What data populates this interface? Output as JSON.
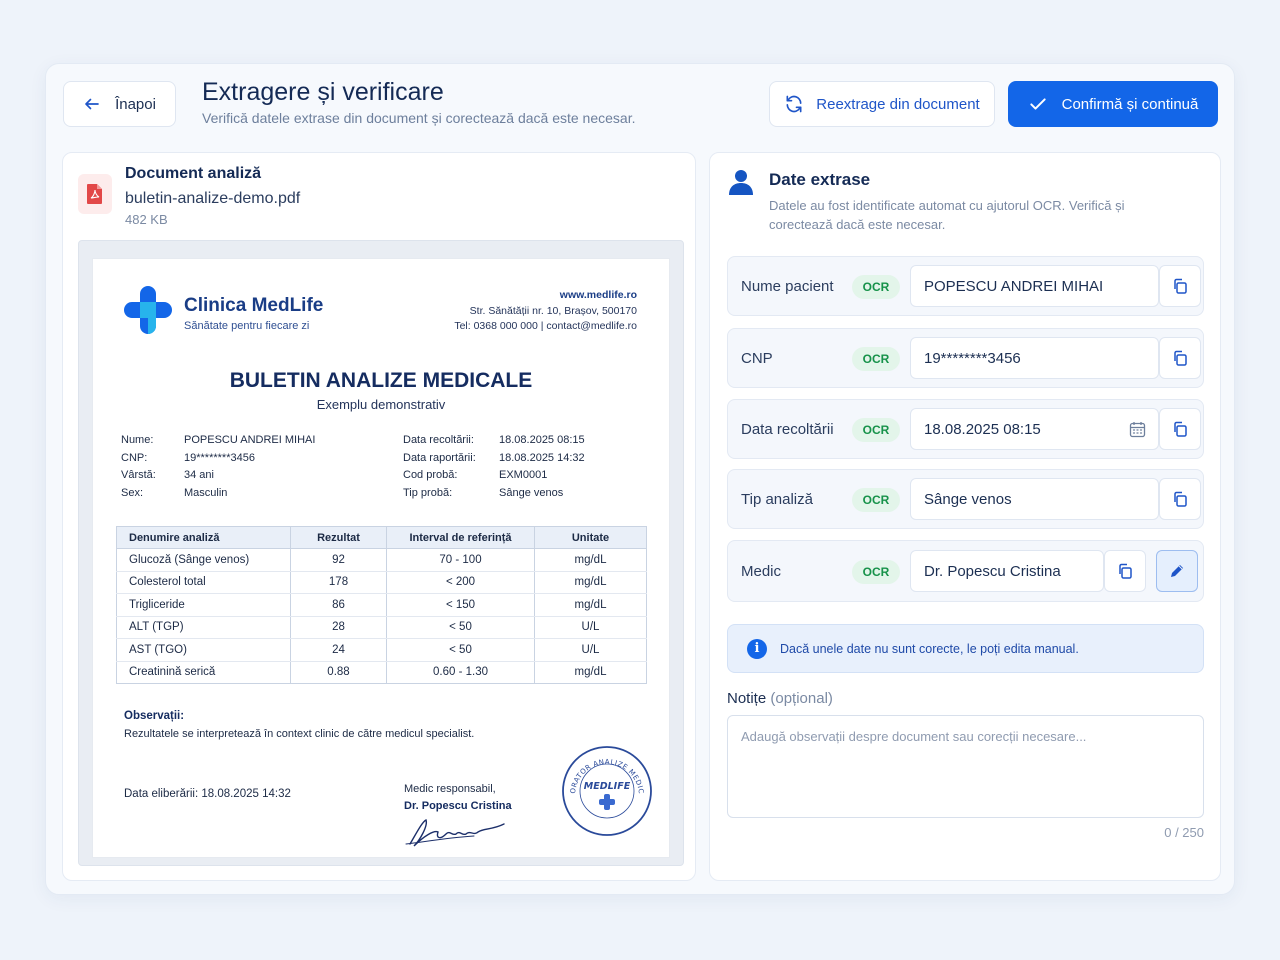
{
  "header": {
    "back_label": "Înapoi",
    "title": "Extragere și verificare",
    "subtitle": "Verifică datele extrase din document și corectează dacă este necesar.",
    "reextract_label": "Reextrage din document",
    "confirm_label": "Confirmă și continuă"
  },
  "document": {
    "label": "Document analiză",
    "filename": "buletin-analize-demo.pdf",
    "size": "482 KB",
    "icon": "pdf-file-icon"
  },
  "preview": {
    "clinic_name": "Clinica MedLife",
    "clinic_tagline": "Sănătate pentru fiecare zi",
    "website": "www.medlife.ro",
    "address": "Str. Sănătății nr. 10, Brașov, 500170",
    "phone_email": "Tel: 0368 000 000  |  contact@medlife.ro",
    "title": "BULETIN ANALIZE MEDICALE",
    "subtitle": "Exemplu demonstrativ",
    "patient_left": {
      "labels": [
        "Nume:",
        "CNP:",
        "Vârstă:",
        "Sex:"
      ],
      "values": [
        "POPESCU ANDREI MIHAI",
        "19********3456",
        "34 ani",
        "Masculin"
      ]
    },
    "patient_right": {
      "labels": [
        "Data recoltării:",
        "Data raportării:",
        "Cod probă:",
        "Tip probă:"
      ],
      "values": [
        "18.08.2025 08:15",
        "18.08.2025 14:32",
        "EXM0001",
        "Sânge venos"
      ]
    },
    "table": {
      "headers": [
        "Denumire analiză",
        "Rezultat",
        "Interval de referință",
        "Unitate"
      ],
      "rows": [
        [
          "Glucoză (Sânge venos)",
          "92",
          "70 - 100",
          "mg/dL"
        ],
        [
          "Colesterol total",
          "178",
          "< 200",
          "mg/dL"
        ],
        [
          "Trigliceride",
          "86",
          "< 150",
          "mg/dL"
        ],
        [
          "ALT (TGP)",
          "28",
          "< 50",
          "U/L"
        ],
        [
          "AST (TGO)",
          "24",
          "< 50",
          "U/L"
        ],
        [
          "Creatinină serică",
          "0.88",
          "0.60 - 1.30",
          "mg/dL"
        ]
      ]
    },
    "observations_title": "Observații:",
    "observations_text": "Rezultatele se interpretează în context clinic de către medicul specialist.",
    "release_date": "Data eliberării: 18.08.2025 14:32",
    "responsible_label": "Medic responsabil,",
    "responsible_name": "Dr. Popescu Cristina",
    "stamp_text": "LABORATOR ANALIZE MEDICALE",
    "stamp_center": "MEDLIFE"
  },
  "extracted": {
    "title": "Date extrase",
    "description": "Datele au fost identificate automat cu ajutorul OCR. Verifică și corectează dacă este necesar.",
    "ocr_badge": "OCR",
    "fields": [
      {
        "label": "Nume pacient",
        "value": "POPESCU ANDREI MIHAI"
      },
      {
        "label": "CNP",
        "value": "19********3456"
      },
      {
        "label": "Data recoltării",
        "value": "18.08.2025 08:15"
      },
      {
        "label": "Tip analiză",
        "value": "Sânge venos"
      },
      {
        "label": "Medic",
        "value": "Dr. Popescu Cristina"
      }
    ]
  },
  "info_message": "Dacă unele date nu sunt corecte, le poți edita manual.",
  "notes": {
    "label": "Notițe",
    "optional": "(opțional)",
    "placeholder": "Adaugă observații despre document sau corecții necesare...",
    "counter": "0 / 250"
  },
  "colors": {
    "primary": "#1366e8",
    "ocr_green": "#17924a",
    "ocr_bg": "#e3f5ea",
    "heading": "#142a55"
  }
}
